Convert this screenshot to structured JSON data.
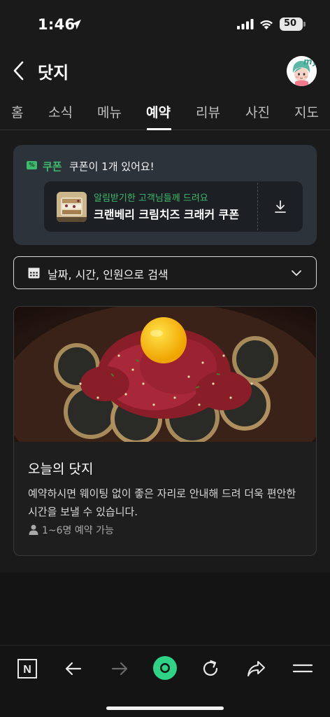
{
  "status_bar": {
    "time": "1:46",
    "battery": "50"
  },
  "header": {
    "title": "닷지",
    "avatar_badge": "my"
  },
  "tabs": [
    {
      "label": "홈"
    },
    {
      "label": "소식"
    },
    {
      "label": "메뉴"
    },
    {
      "label": "예약",
      "active": true
    },
    {
      "label": "리뷰"
    },
    {
      "label": "사진"
    },
    {
      "label": "지도"
    }
  ],
  "coupon": {
    "badge": "%",
    "tag": "쿠폰",
    "count_text": "쿠폰이 1개 있어요!",
    "subtitle": "알림받기한 고객님들께 드려요",
    "name": "크랜베리 크림치즈 크래커 쿠폰"
  },
  "search": {
    "label": "날짜, 시간, 인원으로 검색"
  },
  "reservation": {
    "title": "오늘의 닷지",
    "description": "예약하시면 웨이팅 없이 좋은 자리로 안내해 드려 더욱 편안한 시간을 보낼 수 있습니다.",
    "capacity": "1~6명 예약 가능"
  },
  "toolbar": {
    "home_icon_letter": "N"
  },
  "colors": {
    "accent_green": "#3dba6a",
    "coupon_bg": "#2c333b",
    "page_bg": "#1a1a1a"
  }
}
